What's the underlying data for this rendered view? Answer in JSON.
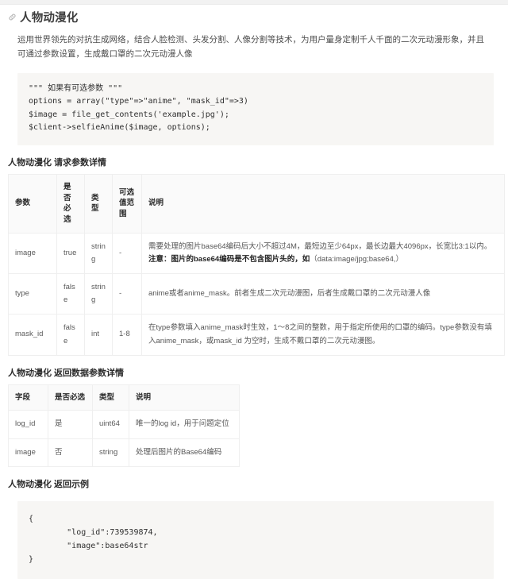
{
  "page": {
    "title": "人物动漫化",
    "anchor_icon": "link-anchor-icon",
    "intro": "运用世界领先的对抗生成网络，结合人脸检测、头发分割、人像分割等技术，为用户量身定制千人千面的二次元动漫形象，并且可通过参数设置，生成戴口罩的二次元动漫人像"
  },
  "code_sample": {
    "language": "php",
    "text": "\"\"\" 如果有可选参数 \"\"\"\noptions = array(\"type\"=>\"anime\", \"mask_id\"=>3)\n$image = file_get_contents('example.jpg');\n$client->selfieAnime($image, options);"
  },
  "request_section": {
    "heading": "人物动漫化 请求参数详情",
    "columns": [
      "参数",
      "是否必选",
      "类型",
      "可选值范围",
      "说明"
    ],
    "rows": [
      {
        "name": "image",
        "required": "true",
        "type": "string",
        "range": "-",
        "desc_prefix": "需要处理的图片base64编码后大小不超过4M，最短边至少64px，最长边最大4096px，长宽比3:1以内。",
        "desc_bold": "注意：图片的base64编码是不包含图片头的，如",
        "desc_suffix": "（data:image/jpg;base64,）"
      },
      {
        "name": "type",
        "required": "false",
        "type": "string",
        "range": "-",
        "desc_prefix": "anime或者anime_mask。前者生成二次元动漫图，后者生成戴口罩的二次元动漫人像",
        "desc_bold": "",
        "desc_suffix": ""
      },
      {
        "name": "mask_id",
        "required": "false",
        "type": "int",
        "range": "1-8",
        "desc_prefix": "在type参数填入anime_mask时生效，1～8之间的整数，用于指定所使用的口罩的编码。type参数没有填入anime_mask，或mask_id 为空时，生成不戴口罩的二次元动漫图。",
        "desc_bold": "",
        "desc_suffix": ""
      }
    ]
  },
  "response_section": {
    "heading": "人物动漫化 返回数据参数详情",
    "columns": [
      "字段",
      "是否必选",
      "类型",
      "说明"
    ],
    "rows": [
      {
        "field": "log_id",
        "required": "是",
        "type": "uint64",
        "desc": "唯一的log id，用于问题定位"
      },
      {
        "field": "image",
        "required": "否",
        "type": "string",
        "desc": "处理后图片的Base64编码"
      }
    ]
  },
  "example_section": {
    "heading": "人物动漫化 返回示例",
    "code": "{\n        \"log_id\":739539874,\n        \"image\":base64str\n}"
  }
}
